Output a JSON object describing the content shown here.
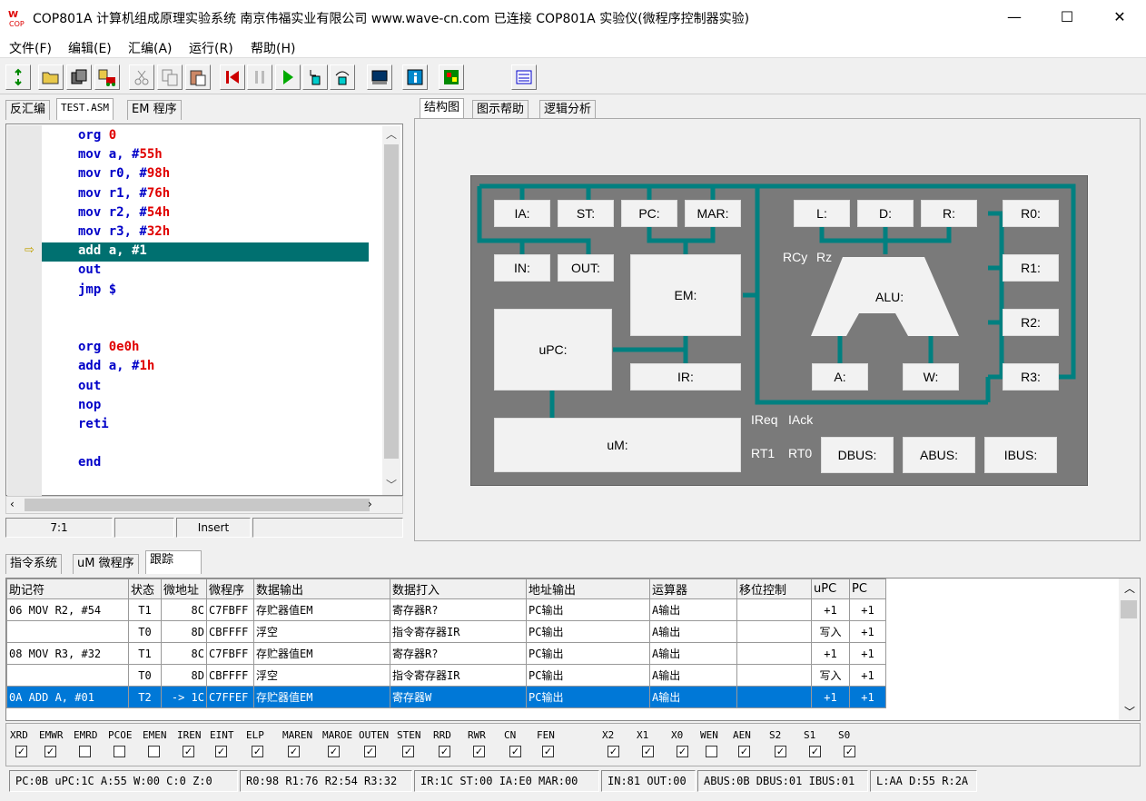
{
  "window": {
    "title": "COP801A 计算机组成原理实验系统  南京伟福实业有限公司  www.wave-cn.com     已连接 COP801A 实验仪(微程序控制器实验)",
    "logo_text": "COP"
  },
  "window_buttons": {
    "minimize": "—",
    "maximize": "☐",
    "close": "✕"
  },
  "menu": [
    "文件(F)",
    "编辑(E)",
    "汇编(A)",
    "运行(R)",
    "帮助(H)"
  ],
  "left_tabs": [
    "反汇编",
    "TEST.ASM",
    "EM 程序"
  ],
  "code": [
    {
      "t": "org ",
      "v": "0"
    },
    {
      "t": "mov a, #",
      "v": "55h"
    },
    {
      "t": "mov r0, #",
      "v": "98h"
    },
    {
      "t": "mov r1, #",
      "v": "76h"
    },
    {
      "t": "mov r2, #",
      "v": "54h"
    },
    {
      "t": "mov r3, #",
      "v": "32h"
    },
    {
      "t": "add a, #1",
      "v": ""
    },
    {
      "t": "out",
      "v": ""
    },
    {
      "t": "jmp $",
      "v": ""
    },
    {
      "t": "",
      "v": ""
    },
    {
      "t": "",
      "v": ""
    },
    {
      "t": "org ",
      "v": "0e0h"
    },
    {
      "t": "add a, #",
      "v": "1h"
    },
    {
      "t": "out",
      "v": ""
    },
    {
      "t": "nop",
      "v": ""
    },
    {
      "t": "reti",
      "v": ""
    },
    {
      "t": "",
      "v": ""
    },
    {
      "t": "end",
      "v": ""
    }
  ],
  "editor_status": {
    "pos": "7:1",
    "mode": "Insert"
  },
  "right_tabs": [
    "结构图",
    "图示帮助",
    "逻辑分析"
  ],
  "diagram": {
    "IA": "IA:",
    "ST": "ST:",
    "PC": "PC:",
    "MAR": "MAR:",
    "IN": "IN:",
    "OUT": "OUT:",
    "EM": "EM:",
    "uPC": "uPC:",
    "IR": "IR:",
    "uM": "uM:",
    "L": "L:",
    "D": "D:",
    "R": "R:",
    "ALU": "ALU:",
    "A": "A:",
    "W": "W:",
    "R0": "R0:",
    "R1": "R1:",
    "R2": "R2:",
    "R3": "R3:",
    "DBUS": "DBUS:",
    "ABUS": "ABUS:",
    "IBUS": "IBUS:",
    "RCy": "RCy",
    "Rz": "Rz",
    "IReq": "IReq",
    "IAck": "IAck",
    "RT1": "RT1",
    "RT0": "RT0"
  },
  "bottom_tabs": [
    "指令系统",
    "uM 微程序",
    "跟踪"
  ],
  "table_headers": [
    "助记符",
    "状态",
    "微地址",
    "微程序",
    "数据输出",
    "数据打入",
    "地址输出",
    "运算器",
    "移位控制",
    "uPC",
    "PC"
  ],
  "table_rows": [
    [
      "06 MOV    R2, #54",
      "T1",
      "8C",
      "C7FBFF",
      "存贮器值EM",
      "寄存器R?",
      "PC输出",
      "A输出",
      "",
      "+1",
      "+1"
    ],
    [
      "",
      "T0",
      "8D",
      "CBFFFF",
      "浮空",
      "指令寄存器IR",
      "PC输出",
      "A输出",
      "",
      "写入",
      "+1"
    ],
    [
      "08 MOV    R3, #32",
      "T1",
      "8C",
      "C7FBFF",
      "存贮器值EM",
      "寄存器R?",
      "PC输出",
      "A输出",
      "",
      "+1",
      "+1"
    ],
    [
      "",
      "T0",
      "8D",
      "CBFFFF",
      "浮空",
      "指令寄存器IR",
      "PC输出",
      "A输出",
      "",
      "写入",
      "+1"
    ],
    [
      "0A ADD    A, #01",
      "T2",
      "-> 1C",
      "C7FFEF",
      "存贮器值EM",
      "寄存器W",
      "PC输出",
      "A输出",
      "",
      "+1",
      "+1"
    ]
  ],
  "controls": [
    {
      "n": "XRD",
      "c": true
    },
    {
      "n": "EMWR",
      "c": true
    },
    {
      "n": "EMRD",
      "c": false
    },
    {
      "n": "PCOE",
      "c": false
    },
    {
      "n": "EMEN",
      "c": false
    },
    {
      "n": "IREN",
      "c": true
    },
    {
      "n": "EINT",
      "c": true
    },
    {
      "n": "ELP",
      "c": true
    },
    {
      "n": "MAREN",
      "c": true
    },
    {
      "n": "MAROE",
      "c": true
    },
    {
      "n": "OUTEN",
      "c": true
    },
    {
      "n": "STEN",
      "c": true
    },
    {
      "n": "RRD",
      "c": true
    },
    {
      "n": "RWR",
      "c": true
    },
    {
      "n": "CN",
      "c": true
    },
    {
      "n": "FEN",
      "c": true
    },
    {
      "n": "X2",
      "c": true
    },
    {
      "n": "X1",
      "c": true
    },
    {
      "n": "X0",
      "c": true
    },
    {
      "n": "WEN",
      "c": false
    },
    {
      "n": "AEN",
      "c": true
    },
    {
      "n": "S2",
      "c": true
    },
    {
      "n": "S1",
      "c": true
    },
    {
      "n": "S0",
      "c": true
    }
  ],
  "status": [
    "PC:0B  uPC:1C  A:55  W:00  C:0  Z:0",
    "R0:98  R1:76  R2:54  R3:32",
    "IR:1C  ST:00  IA:E0  MAR:00",
    "IN:81  OUT:00",
    "ABUS:0B  DBUS:01  IBUS:01",
    "L:AA  D:55  R:2A"
  ],
  "colors": {
    "bus": "#008080",
    "diagram_bg": "#7a7a7a",
    "highlight": "#007070",
    "selection": "#0078d7"
  }
}
